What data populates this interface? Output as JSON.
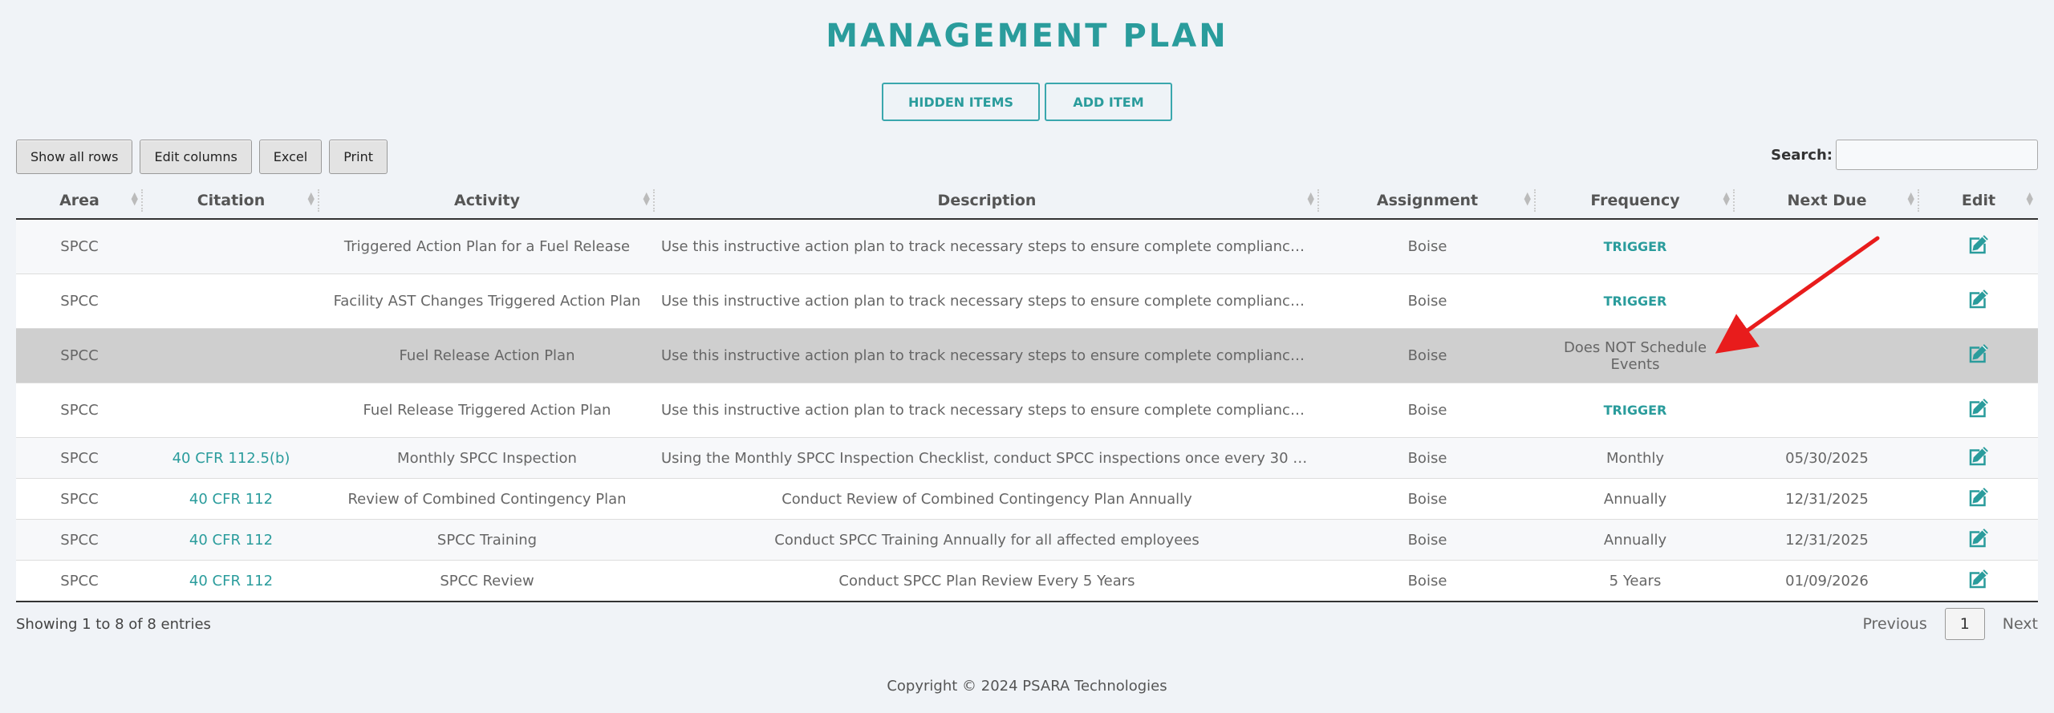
{
  "page_title": "MANAGEMENT PLAN",
  "top_actions": {
    "hidden_items": "HIDDEN ITEMS",
    "add_item": "ADD ITEM"
  },
  "toolbar": {
    "show_all_rows": "Show all rows",
    "edit_columns": "Edit columns",
    "excel": "Excel",
    "print": "Print"
  },
  "search": {
    "label": "Search:",
    "value": ""
  },
  "table": {
    "headers": [
      "Area",
      "Citation",
      "Activity",
      "Description",
      "Assignment",
      "Frequency",
      "Next Due",
      "Edit"
    ],
    "rows": [
      {
        "area": "SPCC",
        "citation": "",
        "activity": "Triggered Action Plan for a Fuel Release",
        "description": "Use this instructive action plan to track necessary steps to ensure complete compliance with f...",
        "assignment": "Boise",
        "frequency": "TRIGGER",
        "next_due": ""
      },
      {
        "area": "SPCC",
        "citation": "",
        "activity": "Facility AST Changes Triggered Action Plan",
        "description": "Use this instructive action plan to track necessary steps to ensure complete compliance with f...",
        "assignment": "Boise",
        "frequency": "TRIGGER",
        "next_due": ""
      },
      {
        "area": "SPCC",
        "citation": "",
        "activity": "Fuel Release Action Plan",
        "description": "Use this instructive action plan to track necessary steps to ensure complete compliance with f...",
        "assignment": "Boise",
        "frequency": "Does NOT Schedule Events",
        "next_due": ""
      },
      {
        "area": "SPCC",
        "citation": "",
        "activity": "Fuel Release Triggered Action Plan",
        "description": "Use this instructive action plan to track necessary steps to ensure complete compliance with f...",
        "assignment": "Boise",
        "frequency": "TRIGGER",
        "next_due": ""
      },
      {
        "area": "SPCC",
        "citation": "40 CFR 112.5(b)",
        "activity": "Monthly SPCC Inspection",
        "description": "Using the Monthly SPCC Inspection Checklist, conduct SPCC inspections once every 30 days. ...",
        "assignment": "Boise",
        "frequency": "Monthly",
        "next_due": "05/30/2025"
      },
      {
        "area": "SPCC",
        "citation": "40 CFR 112",
        "activity": "Review of Combined Contingency Plan",
        "description": "Conduct Review of Combined Contingency Plan Annually",
        "assignment": "Boise",
        "frequency": "Annually",
        "next_due": "12/31/2025"
      },
      {
        "area": "SPCC",
        "citation": "40 CFR 112",
        "activity": "SPCC Training",
        "description": "Conduct SPCC Training Annually for all affected employees",
        "assignment": "Boise",
        "frequency": "Annually",
        "next_due": "12/31/2025"
      },
      {
        "area": "SPCC",
        "citation": "40 CFR 112",
        "activity": "SPCC Review",
        "description": "Conduct SPCC Plan Review Every 5 Years",
        "assignment": "Boise",
        "frequency": "5 Years",
        "next_due": "01/09/2026"
      }
    ]
  },
  "footer": {
    "info": "Showing 1 to 8 of 8 entries",
    "previous": "Previous",
    "page": "1",
    "next": "Next",
    "copyright": "Copyright © 2024 PSARA Technologies"
  },
  "colors": {
    "accent": "#2a9c9c",
    "arrow": "#e81c1c",
    "selected_row": "#cfcfcf"
  },
  "icons": {
    "edit": "edit-icon",
    "sort": "sort-icon"
  }
}
